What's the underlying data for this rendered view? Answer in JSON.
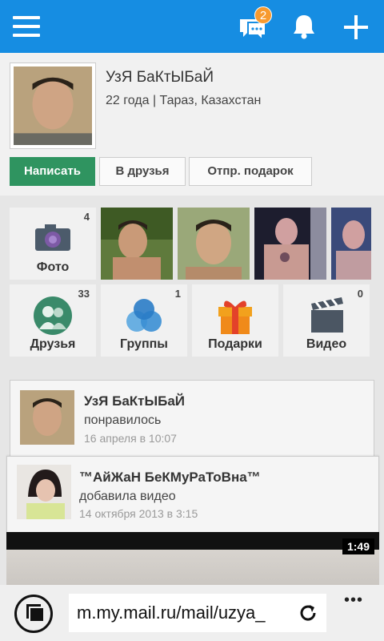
{
  "header": {
    "messages_badge": "2",
    "icons": [
      "menu-icon",
      "messages-icon",
      "bell-icon",
      "plus-icon"
    ],
    "accent": "#168de2"
  },
  "profile": {
    "name": "УзЯ БаКтЫБаЙ",
    "info": "22 года | Тараз, Казахстан",
    "buttons": {
      "write": "Написать",
      "add_friend": "В друзья",
      "send_gift": "Отпр. подарок"
    }
  },
  "sections": {
    "photo": {
      "label": "Фото",
      "count": "4"
    },
    "friends": {
      "label": "Друзья",
      "count": "33"
    },
    "groups": {
      "label": "Группы",
      "count": "1"
    },
    "gifts": {
      "label": "Подарки",
      "count": ""
    },
    "video": {
      "label": "Видео",
      "count": "0"
    }
  },
  "feed": [
    {
      "name": "УзЯ БаКтЫБаЙ",
      "action": "понравилось",
      "time": "16 апреля в 10:07"
    },
    {
      "name": "™АйЖаН БеКМуРаТоВна™",
      "action": "добавила видео",
      "time": "14 октября 2013 в 3:15",
      "duration": "1:49"
    }
  ],
  "browser": {
    "url": "m.my.mail.ru/mail/uzya_",
    "more": "•••"
  }
}
